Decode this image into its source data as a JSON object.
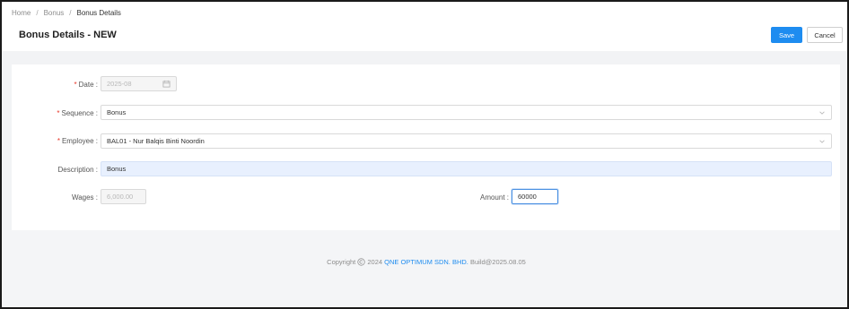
{
  "breadcrumb": {
    "home": "Home",
    "separator": "/",
    "bonus": "Bonus",
    "current": "Bonus Details"
  },
  "page": {
    "title": "Bonus Details - NEW"
  },
  "actions": {
    "save": "Save",
    "cancel": "Cancel"
  },
  "form": {
    "date": {
      "label": "Date :",
      "value": "2025-08",
      "required": "*"
    },
    "sequence": {
      "label": "Sequence :",
      "value": "Bonus",
      "required": "*"
    },
    "employee": {
      "label": "Employee :",
      "value": "BAL01 - Nur Balqis Binti Noordin",
      "required": "*"
    },
    "description": {
      "label": "Description :",
      "value": "Bonus"
    },
    "wages": {
      "label": "Wages :",
      "value": "6,000.00"
    },
    "amount": {
      "label": "Amount :",
      "value": "60000"
    }
  },
  "footer": {
    "prefix": "Copyright",
    "year": "2024",
    "company": "QNE OPTIMUM SDN. BHD.",
    "build": "Build@2025.08.05"
  },
  "colors": {
    "accent": "#1e8cf0",
    "required": "#e8372a",
    "panel": "#f2f3f5"
  }
}
